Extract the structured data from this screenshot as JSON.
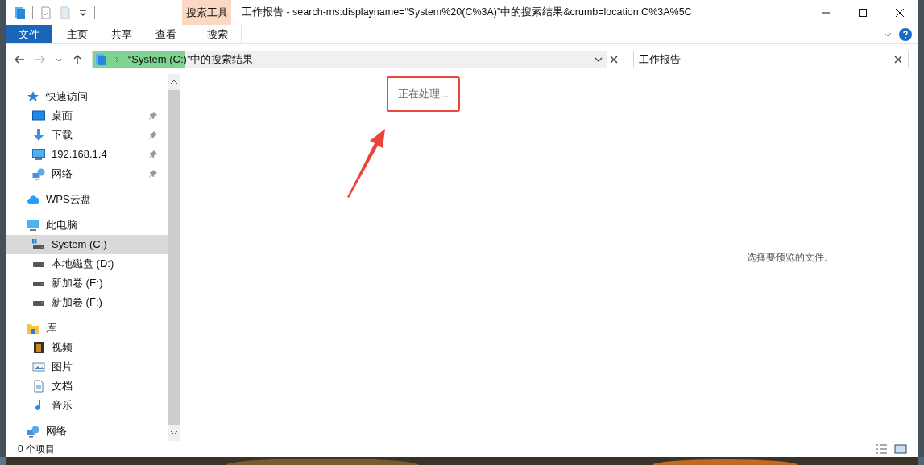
{
  "window": {
    "title": "工作报告 - search-ms:displayname=“System%20(C%3A)”中的搜索结果&crumb=location:C%3A%5C",
    "context_tab_group": "搜索工具"
  },
  "ribbon_tabs": [
    {
      "label": "文件",
      "kind": "file",
      "selected": false
    },
    {
      "label": "主页",
      "kind": "tab",
      "selected": false
    },
    {
      "label": "共享",
      "kind": "tab",
      "selected": false
    },
    {
      "label": "查看",
      "kind": "tab",
      "selected": false
    },
    {
      "label": "搜索",
      "kind": "context",
      "selected": false
    }
  ],
  "address_bar": {
    "path": "“System (C:)”中的搜索结果",
    "level": 0.18
  },
  "search": {
    "value": "工作报告"
  },
  "sidebar": {
    "items": [
      {
        "label": "快速访问",
        "selected": false,
        "pinned": false,
        "children": [
          {
            "label": "桌面",
            "selected": false,
            "pinned": true
          },
          {
            "label": "下载",
            "selected": false,
            "pinned": true
          },
          {
            "label": "192.168.1.4",
            "selected": false,
            "pinned": true
          },
          {
            "label": "网络",
            "selected": false,
            "pinned": true
          }
        ]
      },
      {
        "label": "WPS云盘",
        "selected": false,
        "pinned": false
      },
      {
        "label": "此电脑",
        "selected": false,
        "pinned": false,
        "children": [
          {
            "label": "System (C:)",
            "selected": true,
            "pinned": false
          },
          {
            "label": "本地磁盘 (D:)",
            "selected": false,
            "pinned": false
          },
          {
            "label": "新加卷 (E:)",
            "selected": false,
            "pinned": false
          },
          {
            "label": "新加卷 (F:)",
            "selected": false,
            "pinned": false
          }
        ]
      },
      {
        "label": "库",
        "selected": false,
        "pinned": false,
        "children": [
          {
            "label": "视频",
            "selected": false,
            "pinned": false
          },
          {
            "label": "图片",
            "selected": false,
            "pinned": false
          },
          {
            "label": "文档",
            "selected": false,
            "pinned": false
          },
          {
            "label": "音乐",
            "selected": false,
            "pinned": false
          }
        ]
      },
      {
        "label": "网络",
        "selected": false,
        "pinned": false
      }
    ]
  },
  "content": {
    "status": "正在处理..."
  },
  "preview_pane": {
    "message": "选择要预览的文件。"
  },
  "status_bar": {
    "item_count": "0 个项目"
  }
}
